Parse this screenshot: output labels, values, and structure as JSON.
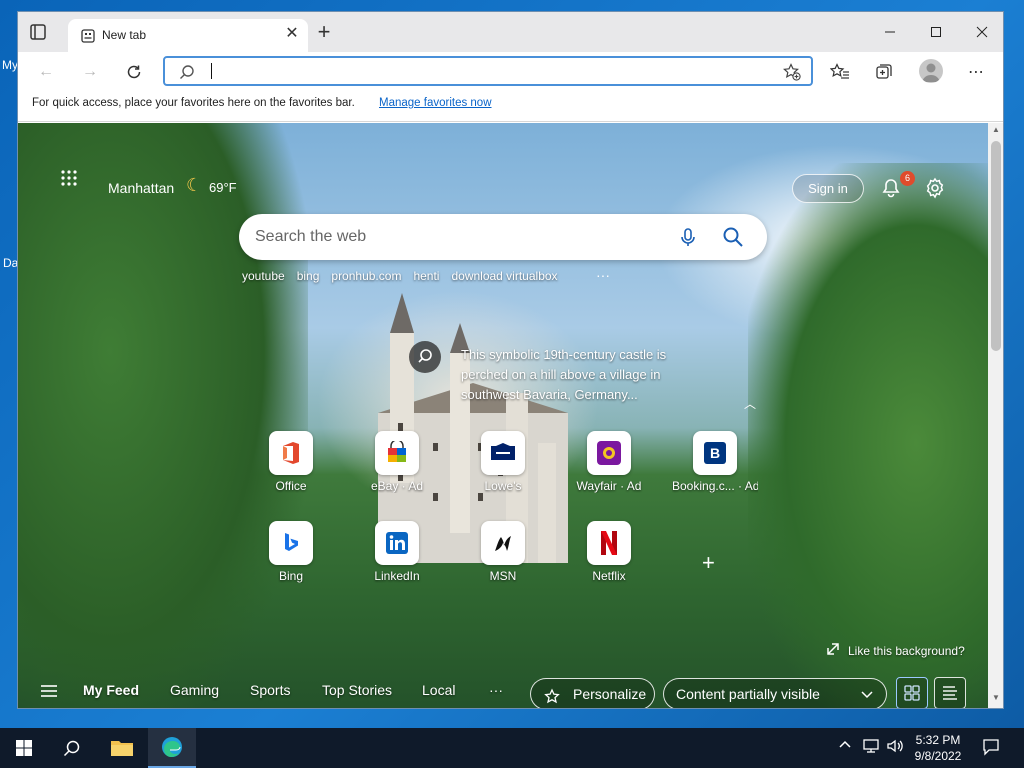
{
  "desktop": {
    "frag1": "My",
    "frag2": "Da"
  },
  "browser": {
    "tab": {
      "title": "New tab"
    },
    "toolbar": {
      "address_value": ""
    },
    "favorites_bar": {
      "hint": "For quick access, place your favorites here on the favorites bar.",
      "link": "Manage favorites now"
    }
  },
  "newtab": {
    "weather": {
      "city": "Manhattan",
      "icon": "moon-icon",
      "temp": "69°F"
    },
    "signin": "Sign in",
    "notifications_count": "6",
    "search": {
      "placeholder": "Search the web",
      "trending": [
        "youtube",
        "bing",
        "pronhub.com",
        "henti",
        "download virtualbox"
      ],
      "trending_more": "···"
    },
    "image_info": "This symbolic 19th-century castle is perched on a hill above a village in southwest Bavaria, Germany...",
    "quick_links": [
      {
        "label": "Office",
        "icon": "office-icon"
      },
      {
        "label": "eBay · Ad",
        "icon": "ebay-icon"
      },
      {
        "label": "Lowe's",
        "icon": "lowes-icon"
      },
      {
        "label": "Wayfair · Ad",
        "icon": "wayfair-icon"
      },
      {
        "label": "Booking.c... · Ad",
        "icon": "booking-icon"
      },
      {
        "label": "Bing",
        "icon": "bing-icon"
      },
      {
        "label": "LinkedIn",
        "icon": "linkedin-icon"
      },
      {
        "label": "MSN",
        "icon": "msn-icon"
      },
      {
        "label": "Netflix",
        "icon": "netflix-icon"
      }
    ],
    "like_background": "Like this background?",
    "feed": {
      "tabs": [
        "My Feed",
        "Gaming",
        "Sports",
        "Top Stories",
        "Local"
      ],
      "more": "···",
      "personalize": "Personalize",
      "content_visibility": "Content partially visible"
    }
  },
  "taskbar": {
    "time": "5:32 PM",
    "date": "9/8/2022",
    "colors": {
      "accent": "#0a64c9",
      "badge": "#e04b2c"
    }
  }
}
